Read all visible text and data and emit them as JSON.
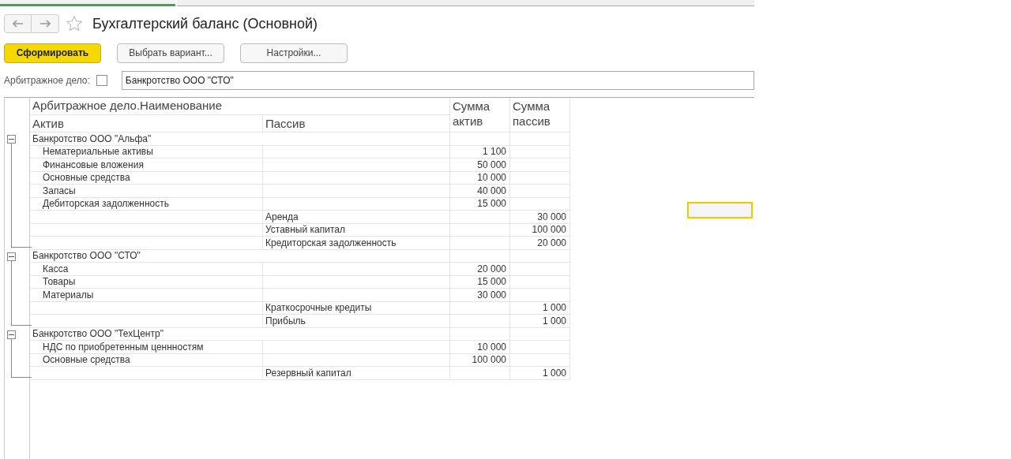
{
  "title": "Бухгалтерский баланс (Основной)",
  "favorite": false,
  "buttons": [
    {
      "label": "Сформировать",
      "kind": "primary"
    },
    {
      "label": "Выбрать вариант...",
      "kind": "normal"
    },
    {
      "label": "Настройки...",
      "kind": "normal"
    }
  ],
  "filter": {
    "label": "Арбитражное дело:",
    "checked": false,
    "value": "Банкротство ООО \"СТО\""
  },
  "table": {
    "columns": {
      "group": "Арбитражное дело.Наименование",
      "aktiv": "Актив",
      "passiv": "Пассив",
      "sum_aktiv": "Сумма актив",
      "sum_passiv": "Сумма пассив"
    },
    "groups": [
      {
        "name": "Банкротство ООО \"Альфа\"",
        "expanded": true,
        "rows": [
          {
            "aktiv": "Нематериальные активы",
            "sum_aktiv": "1 100"
          },
          {
            "aktiv": "Финансовые вложения",
            "sum_aktiv": "50 000"
          },
          {
            "aktiv": "Основные средства",
            "sum_aktiv": "10 000"
          },
          {
            "aktiv": "Запасы",
            "sum_aktiv": "40 000"
          },
          {
            "aktiv": "Дебиторская задолженность",
            "sum_aktiv": "15 000"
          },
          {
            "passiv": "Аренда",
            "sum_passiv": "30 000"
          },
          {
            "passiv": "Уставный капитал",
            "sum_passiv": "100 000"
          },
          {
            "passiv": "Кредиторская задолженность",
            "sum_passiv": "20 000"
          }
        ]
      },
      {
        "name": "Банкротство ООО \"СТО\"",
        "expanded": true,
        "rows": [
          {
            "aktiv": "Касса",
            "sum_aktiv": "20 000"
          },
          {
            "aktiv": "Товары",
            "sum_aktiv": "15 000"
          },
          {
            "aktiv": "Материалы",
            "sum_aktiv": "30 000"
          },
          {
            "passiv": "Краткосрочные кредиты",
            "sum_passiv": "1 000"
          },
          {
            "passiv": "Прибыль",
            "sum_passiv": "1 000"
          }
        ]
      },
      {
        "name": "Банкротство ООО \"ТехЦентр\"",
        "expanded": true,
        "rows": [
          {
            "aktiv": "НДС по приобретенным ценнностям",
            "sum_aktiv": "10 000"
          },
          {
            "aktiv": "Основные средства",
            "sum_aktiv": "100 000"
          },
          {
            "passiv": "Резервный капитал",
            "sum_passiv": "1 000"
          }
        ]
      }
    ]
  }
}
